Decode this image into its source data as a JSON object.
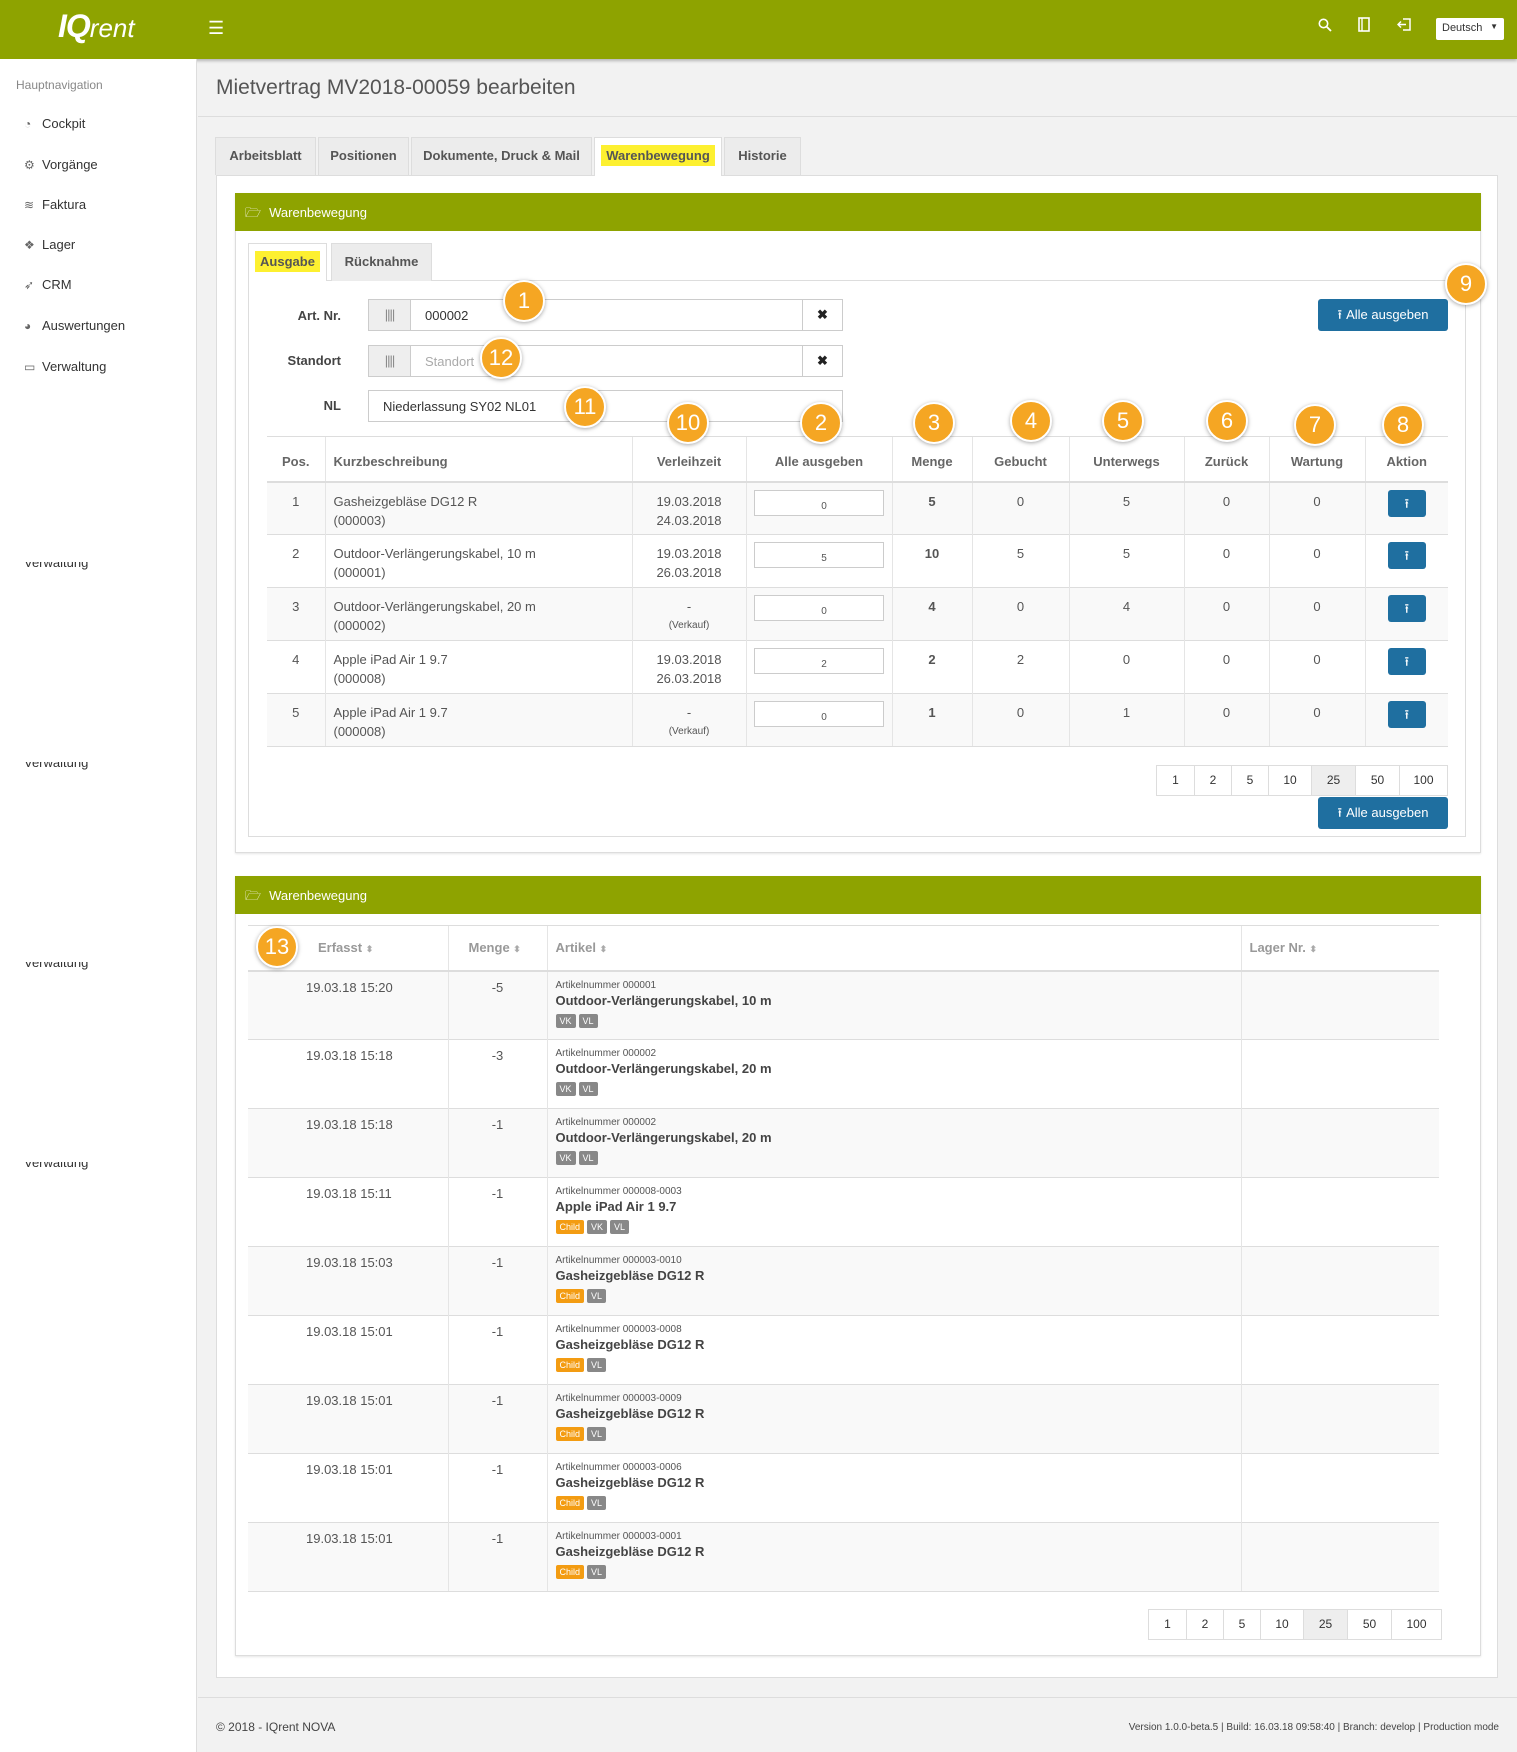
{
  "app": {
    "logo_main": "IQ",
    "logo_rest": "rent",
    "language": "Deutsch"
  },
  "colors": {
    "brand": "#8ea300",
    "primary_button": "#1f6fa0",
    "highlight": "#fdf030",
    "badge": "#f5a623",
    "tag_child": "#f39c12",
    "tag_default": "#888888"
  },
  "sidebar": {
    "title": "Hauptnavigation",
    "items": [
      {
        "label": "Cockpit",
        "icon": "dashboard-icon"
      },
      {
        "label": "Vorgänge",
        "icon": "cogs-icon"
      },
      {
        "label": "Faktura",
        "icon": "layers-icon"
      },
      {
        "label": "Lager",
        "icon": "cubes-icon"
      },
      {
        "label": "CRM",
        "icon": "paper-plane-icon"
      },
      {
        "label": "Auswertungen",
        "icon": "pie-chart-icon"
      },
      {
        "label": "Verwaltung",
        "icon": "folder-icon"
      }
    ],
    "ghost_label": "Verwaltung"
  },
  "page": {
    "title": "Mietvertrag MV2018-00059 bearbeiten"
  },
  "tabs": [
    "Arbeitsblatt",
    "Positionen",
    "Dokumente, Druck & Mail",
    "Warenbewegung",
    "Historie"
  ],
  "panel1": {
    "title": "Warenbewegung",
    "subtabs": [
      "Ausgabe",
      "Rücknahme"
    ],
    "form": {
      "art_label": "Art. Nr.",
      "art_value": "000002",
      "standort_label": "Standort",
      "standort_placeholder": "Standort",
      "nl_label": "NL",
      "nl_value": "Niederlassung SY02 NL01"
    },
    "btn_all": "Alle ausgeben",
    "columns": [
      "Pos.",
      "Kurzbeschreibung",
      "Verleihzeit",
      "Alle ausgeben",
      "Menge",
      "Gebucht",
      "Unterwegs",
      "Zurück",
      "Wartung",
      "Aktion"
    ],
    "rows": [
      {
        "pos": "1",
        "desc": "Gasheizgebläse DG12 R",
        "code": "(000003)",
        "t1": "19.03.2018",
        "t2": "24.03.2018",
        "qty": "0",
        "menge": "5",
        "gebucht": "0",
        "unterwegs": "5",
        "zurueck": "0",
        "wartung": "0"
      },
      {
        "pos": "2",
        "desc": "Outdoor-Verlängerungskabel, 10 m",
        "code": "(000001)",
        "t1": "19.03.2018",
        "t2": "26.03.2018",
        "qty": "5",
        "menge": "10",
        "gebucht": "5",
        "unterwegs": "5",
        "zurueck": "0",
        "wartung": "0"
      },
      {
        "pos": "3",
        "desc": "Outdoor-Verlängerungskabel, 20 m",
        "code": "(000002)",
        "t1": "-",
        "t2": "(Verkauf)",
        "qty": "0",
        "menge": "4",
        "gebucht": "0",
        "unterwegs": "4",
        "zurueck": "0",
        "wartung": "0"
      },
      {
        "pos": "4",
        "desc": "Apple iPad Air 1 9.7",
        "code": "(000008)",
        "t1": "19.03.2018",
        "t2": "26.03.2018",
        "qty": "2",
        "menge": "2",
        "gebucht": "2",
        "unterwegs": "0",
        "zurueck": "0",
        "wartung": "0"
      },
      {
        "pos": "5",
        "desc": "Apple iPad Air 1 9.7",
        "code": "(000008)",
        "t1": "-",
        "t2": "(Verkauf)",
        "qty": "0",
        "menge": "1",
        "gebucht": "0",
        "unterwegs": "1",
        "zurueck": "0",
        "wartung": "0"
      }
    ],
    "pager": [
      "1",
      "2",
      "5",
      "10",
      "25",
      "50",
      "100"
    ],
    "pager_current": "25"
  },
  "panel2": {
    "title": "Warenbewegung",
    "columns": [
      "Erfasst",
      "Menge",
      "Artikel",
      "Lager Nr."
    ],
    "rows": [
      {
        "time": "19.03.18 15:20",
        "menge": "-5",
        "artnr": "Artikelnummer 000001",
        "name": "Outdoor-Verlängerungskabel, 10 m",
        "tags": [
          "VK",
          "VL"
        ]
      },
      {
        "time": "19.03.18 15:18",
        "menge": "-3",
        "artnr": "Artikelnummer 000002",
        "name": "Outdoor-Verlängerungskabel, 20 m",
        "tags": [
          "VK",
          "VL"
        ]
      },
      {
        "time": "19.03.18 15:18",
        "menge": "-1",
        "artnr": "Artikelnummer 000002",
        "name": "Outdoor-Verlängerungskabel, 20 m",
        "tags": [
          "VK",
          "VL"
        ]
      },
      {
        "time": "19.03.18 15:11",
        "menge": "-1",
        "artnr": "Artikelnummer 000008-0003",
        "name": "Apple iPad Air 1 9.7",
        "tags": [
          "Child",
          "VK",
          "VL"
        ]
      },
      {
        "time": "19.03.18 15:03",
        "menge": "-1",
        "artnr": "Artikelnummer 000003-0010",
        "name": "Gasheizgebläse DG12 R",
        "tags": [
          "Child",
          "VL"
        ]
      },
      {
        "time": "19.03.18 15:01",
        "menge": "-1",
        "artnr": "Artikelnummer 000003-0008",
        "name": "Gasheizgebläse DG12 R",
        "tags": [
          "Child",
          "VL"
        ]
      },
      {
        "time": "19.03.18 15:01",
        "menge": "-1",
        "artnr": "Artikelnummer 000003-0009",
        "name": "Gasheizgebläse DG12 R",
        "tags": [
          "Child",
          "VL"
        ]
      },
      {
        "time": "19.03.18 15:01",
        "menge": "-1",
        "artnr": "Artikelnummer 000003-0006",
        "name": "Gasheizgebläse DG12 R",
        "tags": [
          "Child",
          "VL"
        ]
      },
      {
        "time": "19.03.18 15:01",
        "menge": "-1",
        "artnr": "Artikelnummer 000003-0001",
        "name": "Gasheizgebläse DG12 R",
        "tags": [
          "Child",
          "VL"
        ]
      }
    ],
    "pager": [
      "1",
      "2",
      "5",
      "10",
      "25",
      "50",
      "100"
    ],
    "pager_current": "25"
  },
  "badges": [
    "1",
    "2",
    "3",
    "4",
    "5",
    "6",
    "7",
    "8",
    "9",
    "10",
    "11",
    "12",
    "13"
  ],
  "footer": {
    "left": "© 2018 - IQrent NOVA",
    "right": "Version 1.0.0-beta.5 | Build: 16.03.18 09:58:40 | Branch: develop | Production mode"
  }
}
